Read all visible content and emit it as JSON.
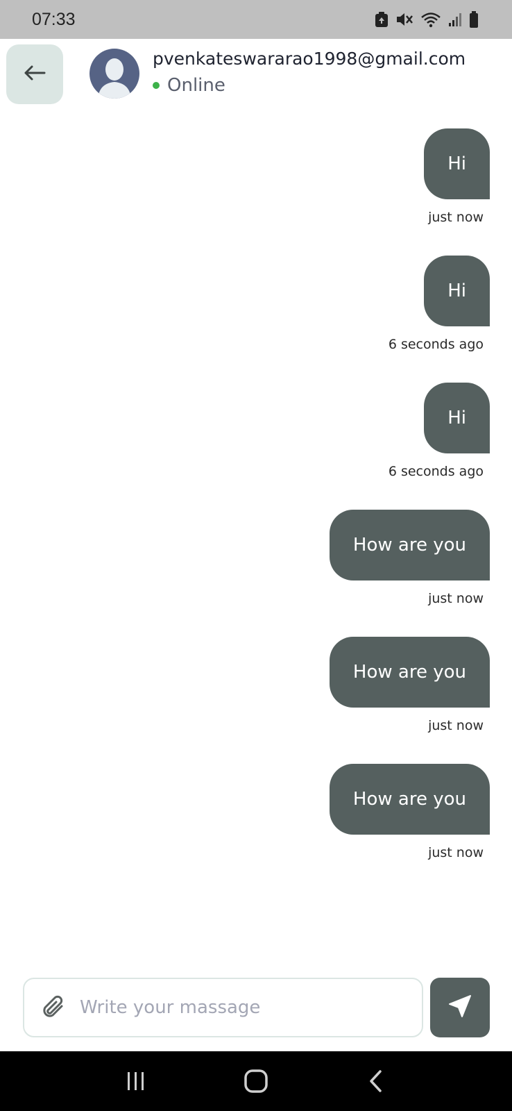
{
  "status_bar": {
    "time": "07:33",
    "icons": [
      "battery-saver-icon",
      "mute-icon",
      "wifi-icon",
      "signal-icon",
      "battery-icon"
    ]
  },
  "header": {
    "back_icon": "arrow-left-icon",
    "contact_name": "pvenkateswararao1998@gmail.com",
    "presence": "Online",
    "presence_color": "#3db24a"
  },
  "messages": [
    {
      "text": "Hi",
      "time": "just now"
    },
    {
      "text": "Hi",
      "time": "6 seconds ago"
    },
    {
      "text": "Hi",
      "time": "6 seconds ago"
    },
    {
      "text": "How are you",
      "time": "just now"
    },
    {
      "text": "How are you",
      "time": "just now"
    },
    {
      "text": "How are you",
      "time": "just now"
    }
  ],
  "composer": {
    "attach_icon": "paperclip-icon",
    "placeholder": "Write your massage",
    "value": "",
    "send_icon": "send-icon"
  },
  "nav_bar": {
    "icons": [
      "recent-apps-icon",
      "home-icon",
      "back-icon"
    ]
  },
  "colors": {
    "bubble": "#55605f",
    "back_button_bg": "#dbe6e3",
    "avatar_bg": "#566385",
    "status_bar_bg": "#bfbfbf"
  }
}
